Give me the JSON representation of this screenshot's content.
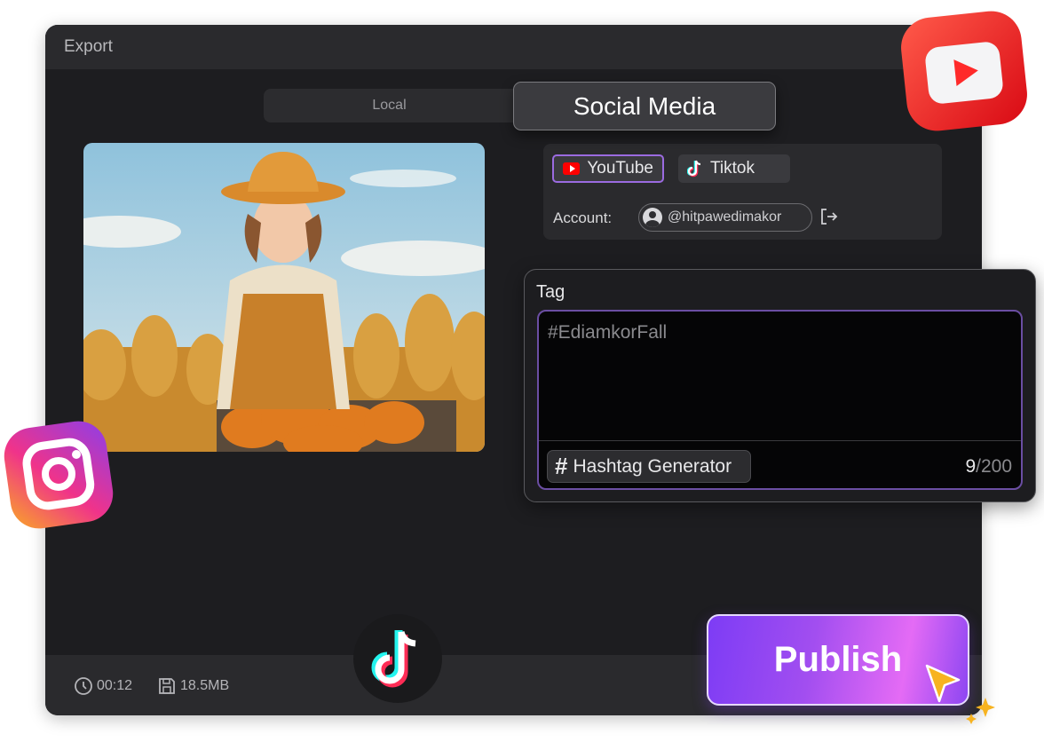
{
  "window": {
    "title": "Export"
  },
  "tabs": {
    "local": "Local",
    "social_media": "Social Media",
    "active": "social_media"
  },
  "platforms": [
    {
      "label": "YouTube",
      "icon": "youtube-icon",
      "selected": true
    },
    {
      "label": "Tiktok",
      "icon": "tiktok-icon",
      "selected": false
    }
  ],
  "account": {
    "label": "Account:",
    "handle": "@hitpawedimakor"
  },
  "tag": {
    "title": "Tag",
    "value": "#EdiamkorFall",
    "generator_label": "Hashtag Generator",
    "count_current": "9",
    "count_max": "/200"
  },
  "footer": {
    "duration": "00:12",
    "size": "18.5MB"
  },
  "publish": {
    "label": "Publish"
  },
  "colors": {
    "accent_purple": "#9b6be0",
    "youtube_red": "#ff0000",
    "publish_gradient_start": "#7d3cf5",
    "publish_gradient_end": "#e46bf5"
  }
}
